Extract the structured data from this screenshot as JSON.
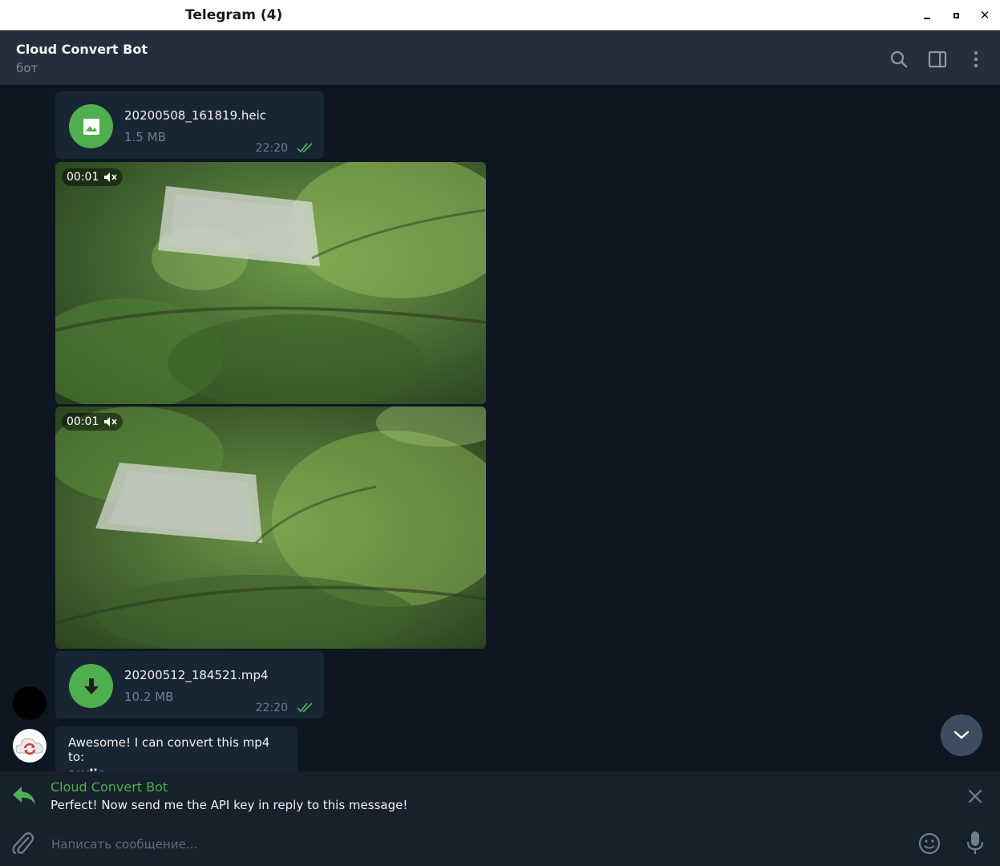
{
  "window": {
    "title": "Telegram (4)",
    "minimize_icon": "minimize-icon",
    "maximize_icon": "maximize-icon",
    "close_glyph": "✕"
  },
  "header": {
    "title": "Cloud Convert Bot",
    "subtitle": "бот",
    "icons": [
      "search-icon",
      "sidebar-icon",
      "more-icon"
    ]
  },
  "messages": {
    "file1": {
      "name": "20200508_161819.heic",
      "size": "1.5 MB",
      "time": "22:20",
      "icon": "image-icon"
    },
    "video1": {
      "duration": "00:01",
      "icon": "mute-icon"
    },
    "video2": {
      "duration": "00:01",
      "icon": "mute-icon"
    },
    "file2": {
      "name": "20200512_184521.mp4",
      "size": "10.2 MB",
      "time": "22:20",
      "icon": "download-icon"
    },
    "bot_msg": {
      "line1": "Awesome! I can convert this mp4 to:",
      "line2": "audio"
    }
  },
  "reply": {
    "name": "Cloud Convert Bot",
    "text": "Perfect! Now send me the API key in reply to this message!"
  },
  "input": {
    "placeholder": "Написать сообщение..."
  },
  "colors": {
    "accent": "#4fae4e",
    "bg_messages": "#0e1621",
    "bg_header": "#242f3d",
    "bubble": "#182533"
  }
}
